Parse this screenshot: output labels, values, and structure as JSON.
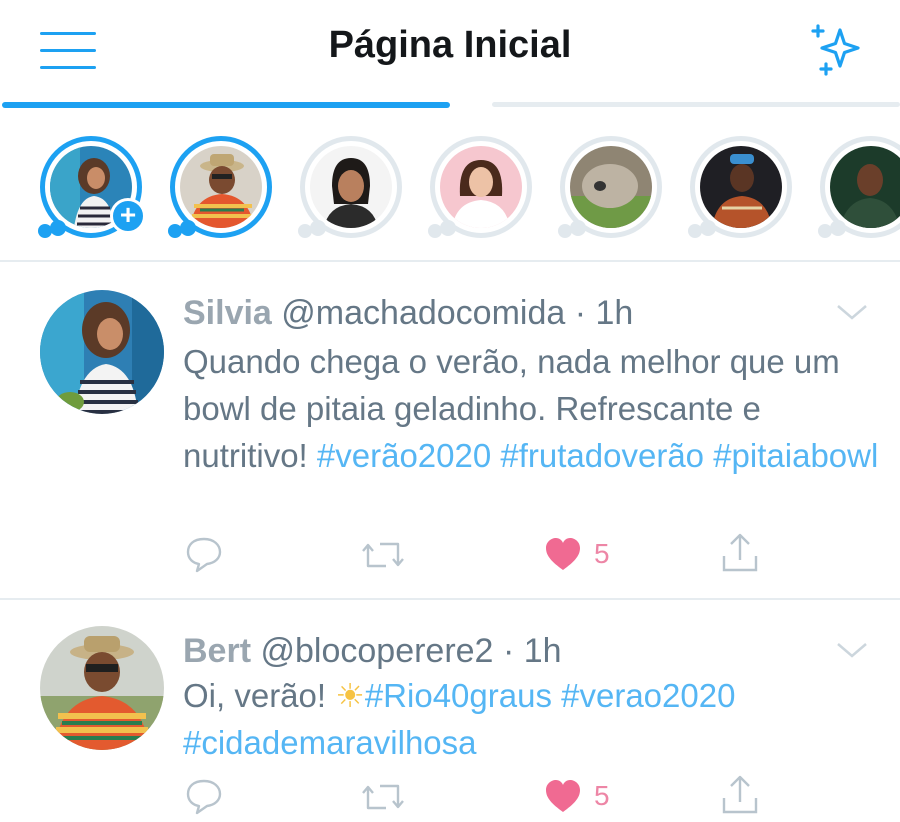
{
  "header": {
    "title": "Página Inicial",
    "menu_icon": "hamburger-menu-icon",
    "sparkle_icon": "sparkle-icon",
    "accent_color": "#1da1f2"
  },
  "stories": [
    {
      "name": "silvia",
      "seen": false,
      "own": true
    },
    {
      "name": "bert",
      "seen": false,
      "own": false
    },
    {
      "name": "story-3",
      "seen": true,
      "own": false
    },
    {
      "name": "story-4",
      "seen": true,
      "own": false
    },
    {
      "name": "story-5",
      "seen": true,
      "own": false
    },
    {
      "name": "story-6",
      "seen": true,
      "own": false
    },
    {
      "name": "story-7",
      "seen": true,
      "own": false
    }
  ],
  "tweets": [
    {
      "name": "Silvia",
      "handle": "@machadocomida",
      "time": "· 1h",
      "text": "Quando chega o verão, nada melhor que um bowl de pitaia geladinho. Refrescante e nutritivo!",
      "hashtags": [
        "#verão2020",
        "#frutadoverão",
        "#pitaiabowl"
      ],
      "likes": "5"
    },
    {
      "name": "Bert",
      "handle": "@blocoperere2",
      "time": "· 1h",
      "text": "Oi, verão!",
      "emoji": "☀",
      "hashtags": [
        "#Rio40graus",
        "#verao2020",
        "#cidademaravilhosa"
      ],
      "likes": "5"
    }
  ],
  "add_story_glyph": "+"
}
